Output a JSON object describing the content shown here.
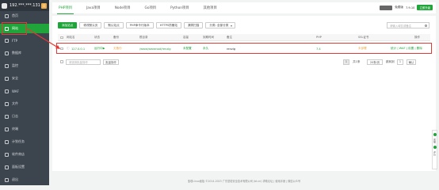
{
  "sidebar": {
    "ip": "192.***.***.131",
    "badge": "0",
    "items": [
      {
        "label": "首页",
        "icon": "home-icon"
      },
      {
        "label": "网站",
        "icon": "globe-icon"
      },
      {
        "label": "FTP",
        "icon": "ftp-icon"
      },
      {
        "label": "数据库",
        "icon": "database-icon"
      },
      {
        "label": "监控",
        "icon": "monitor-icon"
      },
      {
        "label": "安全",
        "icon": "shield-icon"
      },
      {
        "label": "WAF",
        "icon": "waf-icon"
      },
      {
        "label": "文件",
        "icon": "folder-icon"
      },
      {
        "label": "日志",
        "icon": "log-icon"
      },
      {
        "label": "终端",
        "icon": "terminal-icon"
      },
      {
        "label": "计划任务",
        "icon": "clock-icon"
      },
      {
        "label": "软件商店",
        "icon": "store-icon"
      },
      {
        "label": "面板设置",
        "icon": "gear-icon"
      },
      {
        "label": "退出",
        "icon": "logout-icon"
      }
    ]
  },
  "tabs": [
    "PHP项目",
    "Java项目",
    "Node项目",
    "Go项目",
    "Python项目",
    "其他项目"
  ],
  "env": {
    "user": "",
    "label": "免费版",
    "version": "7.9.10",
    "upgrade": "立即升级"
  },
  "toolbar": {
    "add_site": "添加站点",
    "modify_default": "修改默认页",
    "default_site": "默认站点",
    "php_cli": "PHP命令行版本",
    "https_ssl": "HTTPS防窜站",
    "waf": "漏洞扫描",
    "category": "分类: 全部分类"
  },
  "search": {
    "placeholder": "请输入域名或备注"
  },
  "table": {
    "headers": [
      "网站名",
      "状态",
      "备份",
      "根目录",
      "容量",
      "到期时间",
      "备注",
      "PHP",
      "SSL证书",
      "操作"
    ],
    "row": {
      "name": "127.0.0.1",
      "status": "运行中▶",
      "backup": "无备份",
      "root": "/www/wwwroot/renzig",
      "quota": "未配置",
      "expire": "永久",
      "remark": "renzig",
      "php": "7.4",
      "ssl": "未部署",
      "actions": "统计 | WAF | 设置 | 删除"
    }
  },
  "bulk": {
    "placeholder": "请选择批量操作",
    "button": "批量操作"
  },
  "pager": {
    "page": "1",
    "total": "共1条",
    "per_page": "20条/页",
    "goto": "跳转到",
    "goto_val": "1",
    "confirm": "确认"
  },
  "floater": {
    "label1": "客服",
    "label2": "评价"
  },
  "copyright": "宝塔Linux面板 ©2014-2023 广东堡塔安全技术有限公司 (bt.cn)    求助论坛 | 使用手册 | 微信公众号"
}
